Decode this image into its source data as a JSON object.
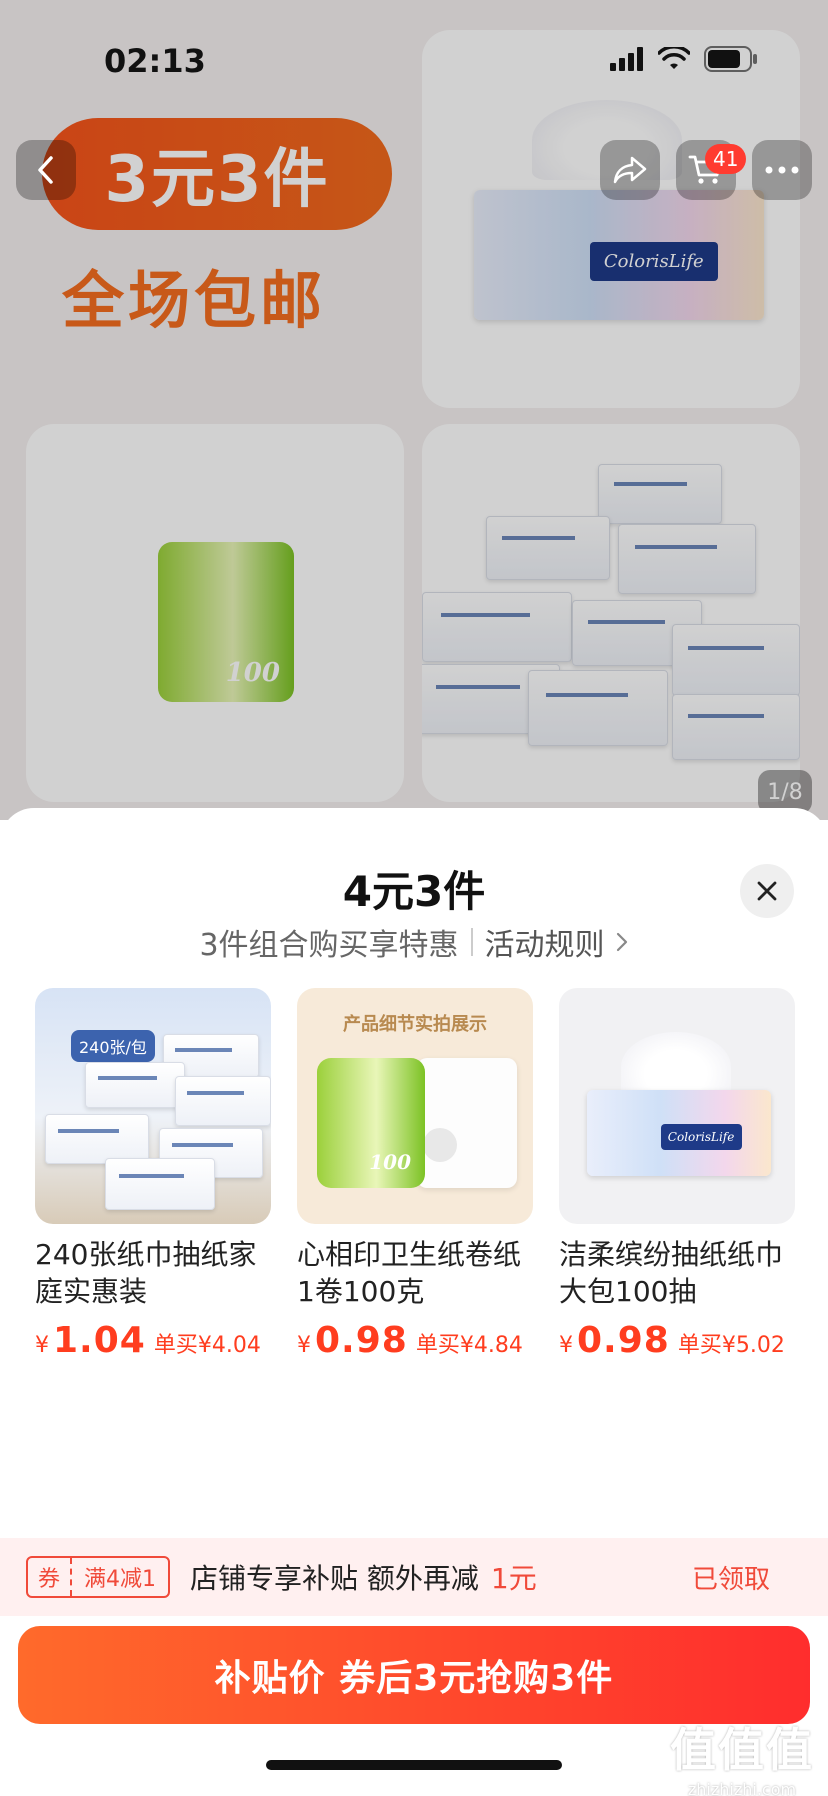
{
  "status_bar": {
    "time": "02:13"
  },
  "nav": {
    "cart_count": "41"
  },
  "banner": {
    "promo_main": "3元3件",
    "promo_sub": "全场包邮"
  },
  "gallery": {
    "counter": "1/8"
  },
  "sheet": {
    "title": "4元3件",
    "subtitle": "3件组合购买享特惠",
    "rules_link": "活动规则",
    "products": [
      {
        "name": "240张纸巾抽纸家庭实惠装",
        "currency": "¥",
        "price": "1.04",
        "single_price": "单买¥4.04",
        "image_badge": "240张/包"
      },
      {
        "name": "心相印卫生纸卷纸1卷100克",
        "currency": "¥",
        "price": "0.98",
        "single_price": "单买¥4.84",
        "image_caption": "产品细节实拍展示"
      },
      {
        "name": "洁柔缤纷抽纸纸巾大包100抽",
        "currency": "¥",
        "price": "0.98",
        "single_price": "单买¥5.02"
      }
    ]
  },
  "coupon": {
    "tag_left": "券",
    "tag_right": "满4减1",
    "text": "店铺专享补贴 额外再减",
    "amount": "1元",
    "status": "已领取"
  },
  "cta": {
    "label": "补贴价 券后3元抢购3件"
  },
  "watermark": {
    "main": "值值值",
    "sub": "zhizhizhi.com"
  },
  "colors": {
    "accent": "#ff3d1f",
    "cta_start": "#ff6a2b",
    "cta_end": "#ff2d2d",
    "promo_orange": "#f46d1f"
  }
}
